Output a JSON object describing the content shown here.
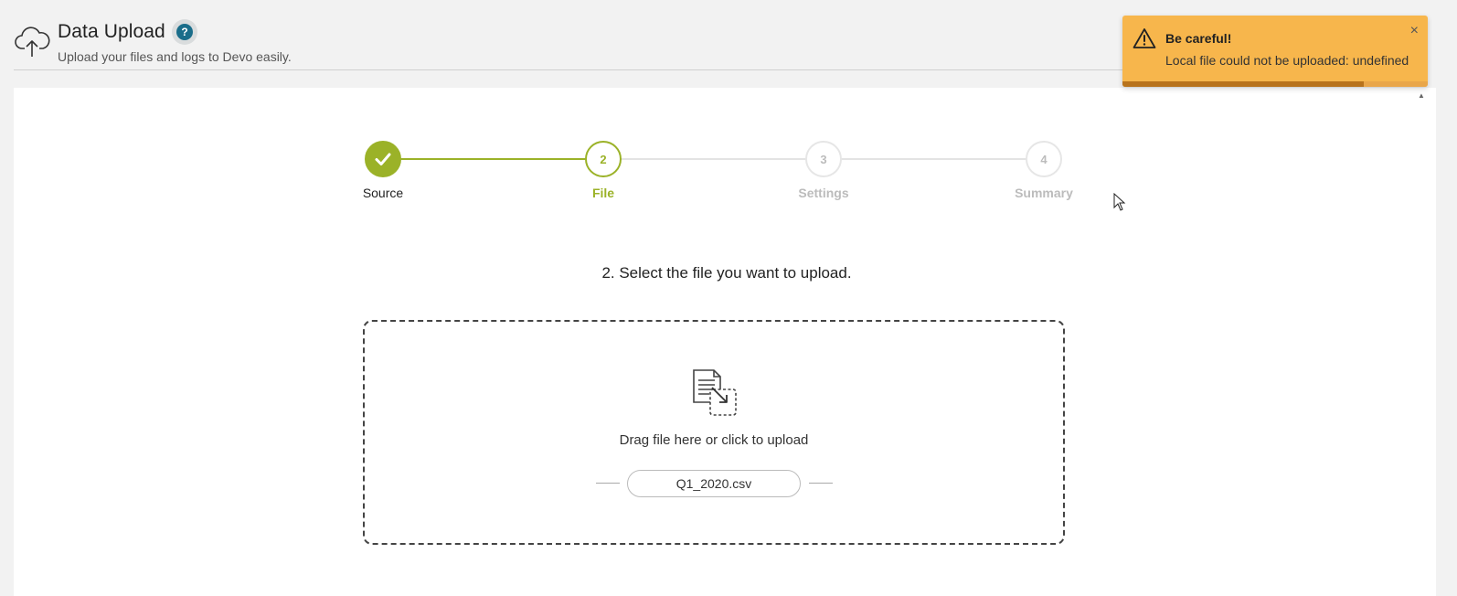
{
  "header": {
    "title": "Data Upload",
    "help_glyph": "?",
    "subtitle": "Upload your files and logs to Devo easily."
  },
  "stepper": {
    "steps": [
      {
        "number": "",
        "label": "Source",
        "state": "complete"
      },
      {
        "number": "2",
        "label": "File",
        "state": "active"
      },
      {
        "number": "3",
        "label": "Settings",
        "state": "pending"
      },
      {
        "number": "4",
        "label": "Summary",
        "state": "pending"
      }
    ],
    "colors": {
      "accent": "#9bb228",
      "pending": "#d5d5d5",
      "pending_text": "#bcbcbc"
    }
  },
  "main": {
    "instruction": "2. Select the file you want to upload.",
    "dropzone_text": "Drag file here or click to upload",
    "selected_file": "Q1_2020.csv"
  },
  "toast": {
    "title": "Be careful!",
    "message": "Local file could not be uploaded: undefined",
    "close_glyph": "×",
    "progress": 0.79,
    "color": "#f7b64c"
  },
  "icons": {
    "header": "cloud-upload-icon",
    "help": "help-icon",
    "step_done": "check-icon",
    "dropzone": "file-drop-icon",
    "toast": "warning-icon",
    "close": "close-icon"
  }
}
